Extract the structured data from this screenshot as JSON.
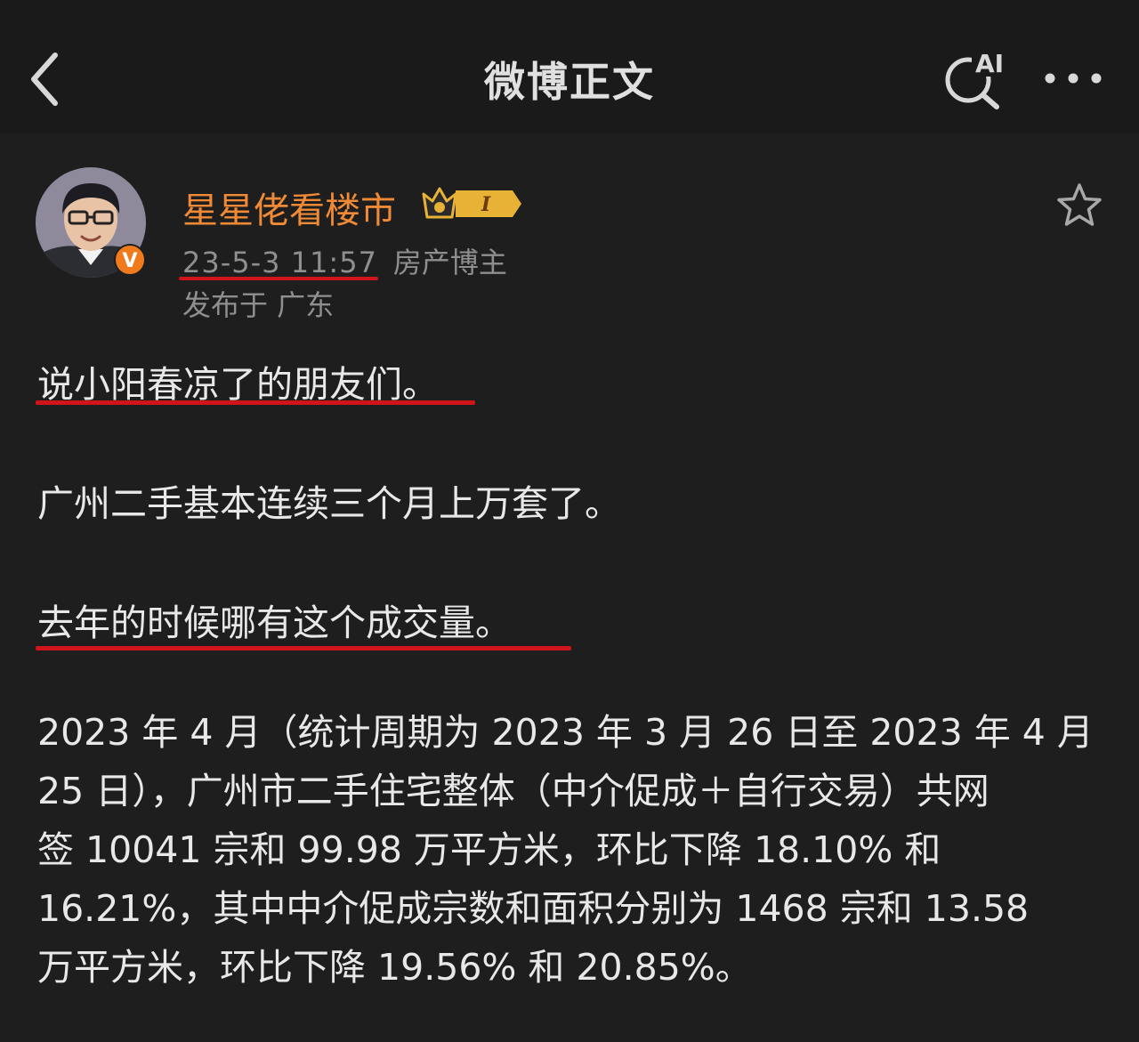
{
  "navbar": {
    "title": "微博正文",
    "back_icon": "chevron-left-icon",
    "ai_label": "AI",
    "ai_icon": "ai-search-icon",
    "more_icon": "more-dots-icon"
  },
  "post": {
    "author": {
      "name": "星星佬看楼市",
      "avatar_icon": "user-avatar",
      "verified_icon": "verified-v-icon",
      "verified_label": "V",
      "badge_icon": "crown-badge-icon",
      "badge_label": "I"
    },
    "timestamp": "23-5-3 11:57",
    "role": "房产博主",
    "location": "发布于 广东",
    "favorite_icon": "star-outline-icon",
    "paragraphs": {
      "p1": "说小阳春凉了的朋友们。",
      "p2": "广州二手基本连续三个月上万套了。",
      "p3": "去年的时候哪有这个成交量。"
    },
    "body_lines": [
      "2023 年 4 月（统计周期为 2023 年 3 月 26 日至 2023 年 4 月",
      "25 日），广州市二手住宅整体（中介促成＋自行交易）共网",
      "签 10041 宗和 99.98 万平方米，环比下降 18.10% 和",
      "16.21%，其中中介促成宗数和面积分别为 1468 宗和 13.58",
      "万平方米，环比下降 19.56% 和 20.85%。"
    ]
  },
  "colors": {
    "background": "#1e1e1e",
    "navbar": "#1a1a1a",
    "author_name": "#f08a37",
    "highlight_underline": "#d0141b",
    "meta_text": "#8f8f8f"
  }
}
